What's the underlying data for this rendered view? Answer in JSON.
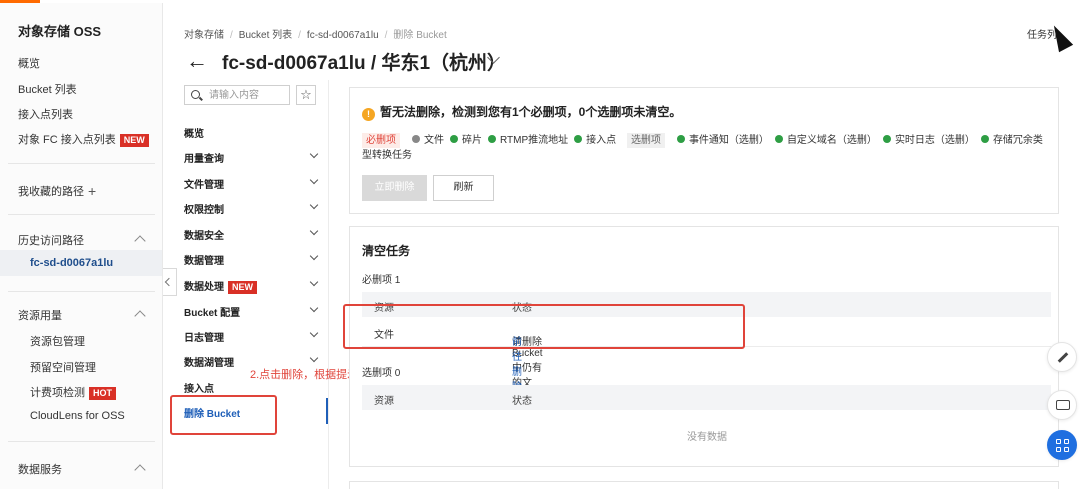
{
  "sidebar": {
    "title": "对象存储 OSS",
    "items": [
      {
        "label": "概览"
      },
      {
        "label": "Bucket 列表"
      },
      {
        "label": "接入点列表"
      },
      {
        "label": "对象 FC 接入点列表",
        "badge": "NEW"
      }
    ],
    "favorites_label": "我收藏的路径",
    "history": {
      "label": "历史访问路径",
      "items": [
        {
          "label": "fc-sd-d0067a1lu"
        }
      ]
    },
    "resource": {
      "label": "资源用量",
      "items": [
        {
          "label": "资源包管理"
        },
        {
          "label": "预留空间管理"
        },
        {
          "label": "计费项检测",
          "badge": "HOT"
        },
        {
          "label": "CloudLens for OSS"
        }
      ]
    },
    "data_service_label": "数据服务"
  },
  "breadcrumb": {
    "items": [
      "对象存储",
      "Bucket 列表",
      "fc-sd-d0067a1lu"
    ],
    "current": "删除 Bucket"
  },
  "header": {
    "task_list": "任务列",
    "title": "fc-sd-d0067a1lu / 华东1（杭州）"
  },
  "bucket_nav": {
    "search_placeholder": "请输入内容",
    "star_glyph": "☆",
    "items": [
      {
        "label": "概览"
      },
      {
        "label": "用量查询"
      },
      {
        "label": "文件管理"
      },
      {
        "label": "权限控制"
      },
      {
        "label": "数据安全"
      },
      {
        "label": "数据管理"
      },
      {
        "label": "数据处理",
        "badge": "NEW"
      },
      {
        "label": "Bucket 配置"
      },
      {
        "label": "日志管理"
      },
      {
        "label": "数据湖管理"
      },
      {
        "label": "接入点"
      },
      {
        "label": "删除 Bucket"
      }
    ]
  },
  "annotation": {
    "text": "2.点击删除，根据提示删除"
  },
  "check_panel": {
    "warning": "暂无法删除，检测到您有1个必删项，0个选删项未清空。",
    "must_tag": "必删项",
    "must_items": [
      "文件",
      "碎片",
      "RTMP推流地址",
      "接入点"
    ],
    "optional_tag": "选删项",
    "optional_items": [
      "事件通知（选删）",
      "自定义域名（选删）",
      "实时日志（选删）",
      "存储冗余类型转换任务"
    ],
    "delete_button": "立即删除",
    "refresh_button": "刷新"
  },
  "clear_tasks": {
    "title": "清空任务",
    "must_title": "必删项 1",
    "columns": [
      "资源",
      "状态"
    ],
    "must_rows": [
      {
        "resource": "文件",
        "status": "请删除Bucket中仍有的文件。",
        "link": "前往删除"
      }
    ],
    "optional_title": "选删项 0",
    "empty_text": "没有数据"
  },
  "colors": {
    "accent": "#ff6a00",
    "link": "#1f5fb8",
    "annotation": "#e0443a",
    "success": "#2e9e44"
  }
}
